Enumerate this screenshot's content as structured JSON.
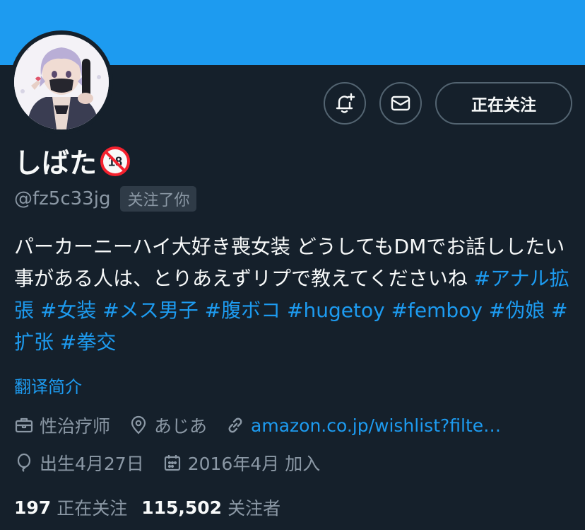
{
  "colors": {
    "background": "#15202b",
    "banner": "#1d9bf0",
    "accent": "#1d9bf0",
    "secondary_text": "#8b98a5",
    "border": "#536471"
  },
  "header": {
    "notify_icon": "bell-plus-icon",
    "message_icon": "envelope-icon",
    "follow_label": "正在关注"
  },
  "profile": {
    "display_name": "しばた",
    "name_badge_icon": "no-under-18-icon",
    "handle": "@fz5c33jg",
    "follows_you": "关注了你",
    "bio_text": "パーカーニーハイ大好き喪女装 どうしてもDMでお話ししたい事がある人は、とりあえずリプで教えてくださいね ",
    "hashtags": [
      "#アナル拡張",
      "#女装",
      "#メス男子",
      "#腹ボコ",
      "#hugetoy",
      "#femboy",
      "#伪娘",
      "#扩张",
      "#拳交"
    ],
    "translate_label": "翻译简介"
  },
  "meta": {
    "profession": "性治疗师",
    "location": "あじあ",
    "link": "amazon.co.jp/wishlist?filte…",
    "birthday": "出生4月27日",
    "joined": "2016年4月 加入"
  },
  "stats": {
    "following_count": "197",
    "following_label": "正在关注",
    "followers_count": "115,502",
    "followers_label": "关注者"
  }
}
